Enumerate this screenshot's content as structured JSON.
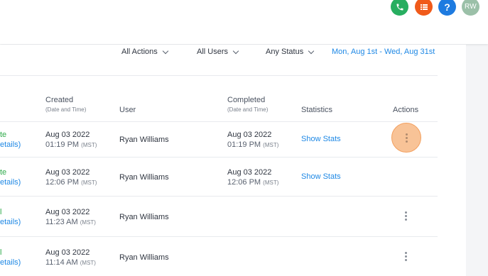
{
  "header": {
    "icons": [
      "phone-icon",
      "tasks-icon",
      "help-icon"
    ],
    "avatar_initials": "RW",
    "help_glyph": "?"
  },
  "filters": {
    "actions": "All Actions",
    "users": "All Users",
    "status": "Any Status",
    "date_range": "Mon, Aug 1st - Wed, Aug 31st"
  },
  "table": {
    "headers": {
      "created": "Created",
      "created_sub": "(Date and Time)",
      "user": "User",
      "completed": "Completed",
      "completed_sub": "(Date and Time)",
      "statistics": "Statistics",
      "actions": "Actions"
    },
    "rows": [
      {
        "status": "te",
        "details": "etails)",
        "created_date": "Aug 03 2022",
        "created_time": "01:19 PM",
        "created_tz": "(MST)",
        "user": "Ryan Williams",
        "completed_date": "Aug 03 2022",
        "completed_time": "01:19 PM",
        "completed_tz": "(MST)",
        "stats": "Show Stats"
      },
      {
        "status": "te",
        "details": "etails)",
        "created_date": "Aug 03 2022",
        "created_time": "12:06 PM",
        "created_tz": "(MST)",
        "user": "Ryan Williams",
        "completed_date": "Aug 03 2022",
        "completed_time": "12:06 PM",
        "completed_tz": "(MST)",
        "stats": "Show Stats"
      },
      {
        "status": "l",
        "details": "etails)",
        "created_date": "Aug 03 2022",
        "created_time": "11:23 AM",
        "created_tz": "(MST)",
        "user": "Ryan Williams"
      },
      {
        "status": "l",
        "details": "etails)",
        "created_date": "Aug 03 2022",
        "created_time": "11:14 AM",
        "created_tz": "(MST)",
        "user": "Ryan Williams"
      }
    ]
  },
  "colors": {
    "accent": "#1e88e5",
    "success": "#2eaa4a",
    "highlight": "#f8c397"
  }
}
